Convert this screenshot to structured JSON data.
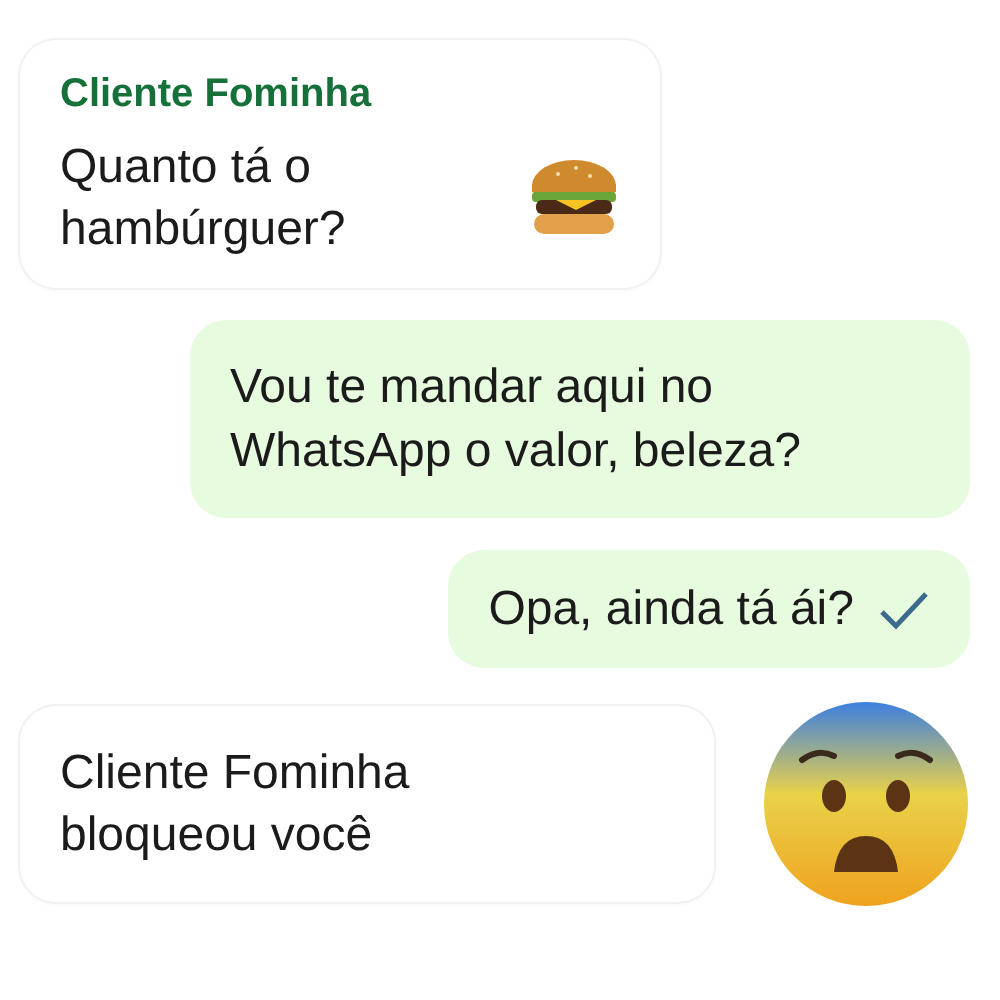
{
  "messages": [
    {
      "kind": "incoming",
      "sender": "Cliente Fominha",
      "text": "Quanto tá o hambúrguer?"
    },
    {
      "kind": "outgoing",
      "text": "Vou te mandar aqui no WhatsApp o valor, beleza?",
      "sent": false
    },
    {
      "kind": "outgoing",
      "text": "Opa, ainda tá ái?",
      "sent": true
    },
    {
      "kind": "incoming",
      "text": "Cliente Fominha bloqueou você"
    }
  ]
}
